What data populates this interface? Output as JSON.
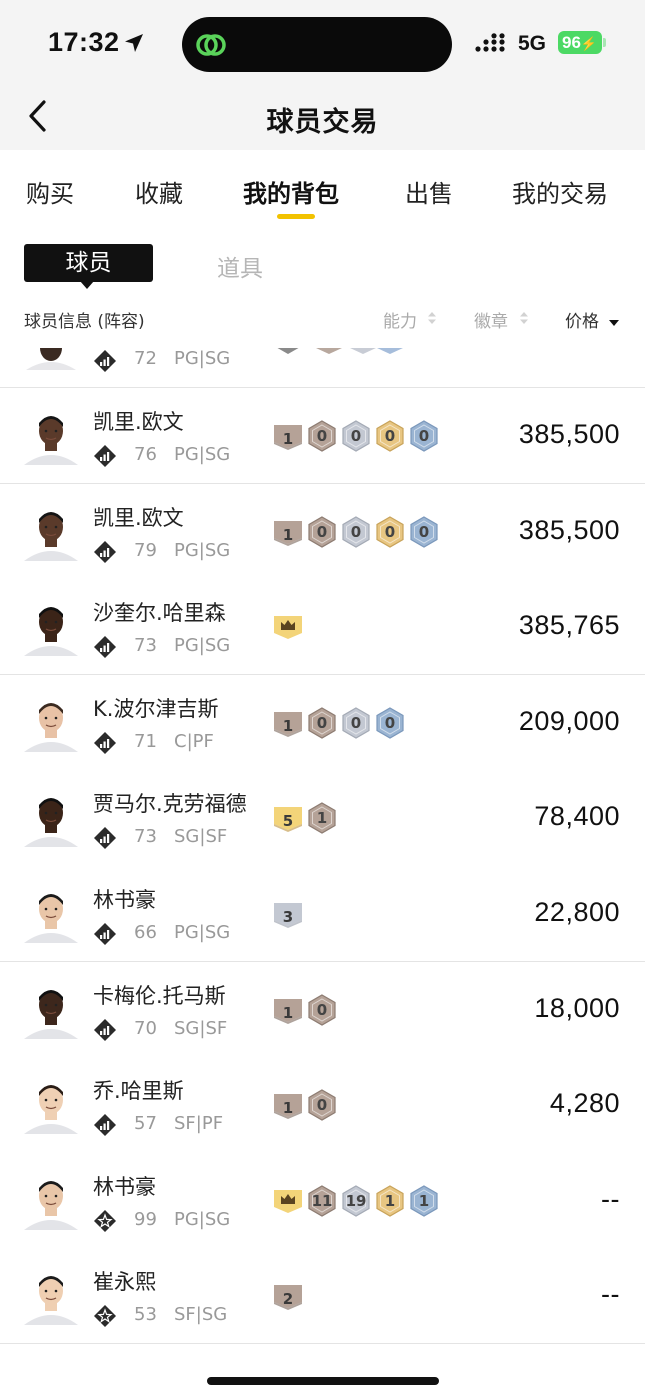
{
  "status_bar": {
    "time": "17:32",
    "network": "5G",
    "battery": "96"
  },
  "header": {
    "title": "球员交易"
  },
  "tabs": [
    {
      "label": "购买"
    },
    {
      "label": "收藏"
    },
    {
      "label": "我的背包",
      "active": true
    },
    {
      "label": "出售"
    },
    {
      "label": "我的交易"
    }
  ],
  "segments": {
    "active": "球员",
    "inactive": "道具"
  },
  "columns": {
    "info": "球员信息 (阵容)",
    "ability": "能力",
    "badge": "徽章",
    "price": "价格"
  },
  "colors": {
    "accent": "#f2c200",
    "gold_badge": "#f3d479",
    "bronze": "#b5a297",
    "silver": "#c3c8d2",
    "blue": "#9ab4d2"
  },
  "partial_row": {
    "rating": "72",
    "position": "PG|SG"
  },
  "rows": [
    {
      "name": "凯里.欧文",
      "rating": "76",
      "position": "PG|SG",
      "rank_icon": "signal-rank-icon",
      "badges": [
        {
          "kind": "tag",
          "color": "bronze",
          "text": "1"
        },
        {
          "kind": "hex",
          "color": "bronze",
          "text": "0"
        },
        {
          "kind": "hex",
          "color": "silver",
          "text": "0"
        },
        {
          "kind": "hex",
          "color": "gold",
          "text": "0"
        },
        {
          "kind": "hex",
          "color": "blue",
          "text": "0"
        }
      ],
      "price": "385,500"
    },
    {
      "name": "凯里.欧文",
      "rating": "79",
      "position": "PG|SG",
      "rank_icon": "signal-rank-icon",
      "badges": [
        {
          "kind": "tag",
          "color": "bronze",
          "text": "1"
        },
        {
          "kind": "hex",
          "color": "bronze",
          "text": "0"
        },
        {
          "kind": "hex",
          "color": "silver",
          "text": "0"
        },
        {
          "kind": "hex",
          "color": "gold",
          "text": "0"
        },
        {
          "kind": "hex",
          "color": "blue",
          "text": "0"
        }
      ],
      "price": "385,500"
    },
    {
      "name": "沙奎尔.哈里森",
      "rating": "73",
      "position": "PG|SG",
      "rank_icon": "signal-rank-icon",
      "badges": [
        {
          "kind": "crown",
          "color": "gold",
          "text": ""
        }
      ],
      "price": "385,765"
    },
    {
      "name": "K.波尔津吉斯",
      "rating": "71",
      "position": "C|PF",
      "rank_icon": "signal-rank-icon",
      "badges": [
        {
          "kind": "tag",
          "color": "bronze",
          "text": "1"
        },
        {
          "kind": "hex",
          "color": "bronze",
          "text": "0"
        },
        {
          "kind": "hex",
          "color": "silver",
          "text": "0"
        },
        {
          "kind": "hex",
          "color": "blue",
          "text": "0"
        }
      ],
      "price": "209,000"
    },
    {
      "name": "贾马尔.克劳福德",
      "rating": "73",
      "position": "SG|SF",
      "rank_icon": "signal-rank-icon",
      "badges": [
        {
          "kind": "tag",
          "color": "gold",
          "text": "5"
        },
        {
          "kind": "hex",
          "color": "bronze",
          "text": "1"
        }
      ],
      "price": "78,400"
    },
    {
      "name": "林书豪",
      "rating": "66",
      "position": "PG|SG",
      "rank_icon": "signal-rank-icon",
      "badges": [
        {
          "kind": "tag",
          "color": "silver",
          "text": "3"
        }
      ],
      "price": "22,800"
    },
    {
      "name": "卡梅伦.托马斯",
      "rating": "70",
      "position": "SG|SF",
      "rank_icon": "signal-rank-icon",
      "badges": [
        {
          "kind": "tag",
          "color": "bronze",
          "text": "1"
        },
        {
          "kind": "hex",
          "color": "bronze",
          "text": "0"
        }
      ],
      "price": "18,000"
    },
    {
      "name": "乔.哈里斯",
      "rating": "57",
      "position": "SF|PF",
      "rank_icon": "signal-rank-icon",
      "badges": [
        {
          "kind": "tag",
          "color": "bronze",
          "text": "1"
        },
        {
          "kind": "hex",
          "color": "bronze",
          "text": "0"
        }
      ],
      "price": "4,280"
    },
    {
      "name": "林书豪",
      "rating": "99",
      "position": "PG|SG",
      "rank_icon": "star-rank-icon",
      "badges": [
        {
          "kind": "crown",
          "color": "gold",
          "text": ""
        },
        {
          "kind": "hex",
          "color": "bronze",
          "text": "11"
        },
        {
          "kind": "hex",
          "color": "silver",
          "text": "19"
        },
        {
          "kind": "hex",
          "color": "gold",
          "text": "1"
        },
        {
          "kind": "hex",
          "color": "blue",
          "text": "1"
        }
      ],
      "price": "--"
    },
    {
      "name": "崔永熙",
      "rating": "53",
      "position": "SF|SG",
      "rank_icon": "star-rank-icon",
      "badges": [
        {
          "kind": "tag",
          "color": "bronze",
          "text": "2"
        }
      ],
      "price": "--"
    }
  ]
}
